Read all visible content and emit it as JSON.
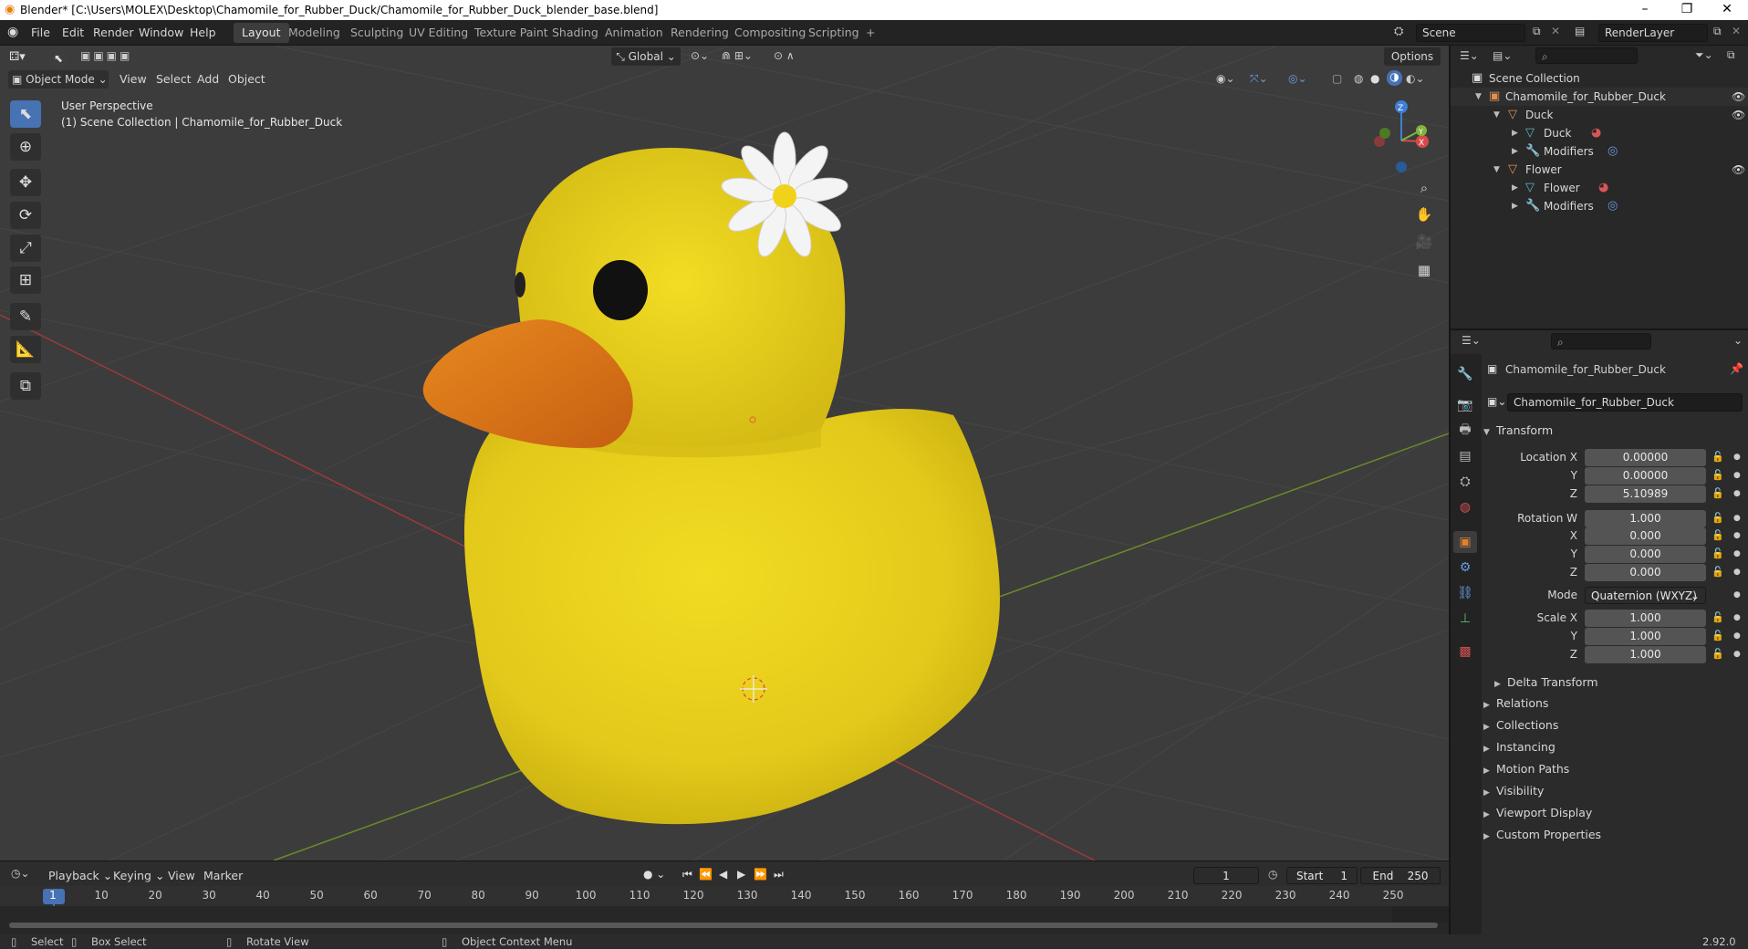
{
  "window": {
    "title": "Blender* [C:\\Users\\MOLEX\\Desktop\\Chamomile_for_Rubber_Duck/Chamomile_for_Rubber_Duck_blender_base.blend]",
    "minimize": "–",
    "maximize": "❐",
    "close": "✕"
  },
  "menus": [
    "File",
    "Edit",
    "Render",
    "Window",
    "Help"
  ],
  "workspaces": [
    "Layout",
    "Modeling",
    "Sculpting",
    "UV Editing",
    "Texture Paint",
    "Shading",
    "Animation",
    "Rendering",
    "Compositing",
    "Scripting",
    "+"
  ],
  "scene": {
    "name": "Scene",
    "render_layer": "RenderLayer"
  },
  "toolbar": {
    "orientation": "Global",
    "options": "Options"
  },
  "viewport": {
    "mode": "Object Mode",
    "menus": [
      "View",
      "Select",
      "Add",
      "Object"
    ],
    "overlay_line1": "User Perspective",
    "overlay_line2": "(1) Scene Collection | Chamomile_for_Rubber_Duck",
    "gizmo": {
      "x": "X",
      "y": "Y",
      "z": "Z"
    }
  },
  "outliner": {
    "root": "Scene Collection",
    "items": [
      {
        "label": "Chamomile_for_Rubber_Duck"
      },
      {
        "label": "Duck"
      },
      {
        "label": "Duck"
      },
      {
        "label": "Modifiers"
      },
      {
        "label": "Flower"
      },
      {
        "label": "Flower"
      },
      {
        "label": "Modifiers"
      }
    ]
  },
  "properties": {
    "object_name": "Chamomile_for_Rubber_Duck",
    "data_name": "Chamomile_for_Rubber_Duck",
    "transform_title": "Transform",
    "location": {
      "label_x": "Location X",
      "label_y": "Y",
      "label_z": "Z",
      "x": "0.00000",
      "y": "0.00000",
      "z": "5.10989"
    },
    "rotation": {
      "label_w": "Rotation W",
      "label_x": "X",
      "label_y": "Y",
      "label_z": "Z",
      "w": "1.000",
      "x": "0.000",
      "y": "0.000",
      "z": "0.000"
    },
    "mode": {
      "label": "Mode",
      "value": "Quaternion (WXYZ)"
    },
    "scale": {
      "label_x": "Scale X",
      "label_y": "Y",
      "label_z": "Z",
      "x": "1.000",
      "y": "1.000",
      "z": "1.000"
    },
    "delta_transform": "Delta Transform",
    "panels": [
      "Relations",
      "Collections",
      "Instancing",
      "Motion Paths",
      "Visibility",
      "Viewport Display",
      "Custom Properties"
    ]
  },
  "timeline": {
    "menus": [
      "Playback",
      "Keying",
      "View",
      "Marker"
    ],
    "current_frame": "1",
    "start_label": "Start",
    "start": "1",
    "end_label": "End",
    "end": "250",
    "ruler": [
      "1",
      "10",
      "20",
      "30",
      "40",
      "50",
      "60",
      "70",
      "80",
      "90",
      "100",
      "110",
      "120",
      "130",
      "140",
      "150",
      "160",
      "170",
      "180",
      "190",
      "200",
      "210",
      "220",
      "230",
      "240",
      "250"
    ]
  },
  "statusbar": {
    "select": "Select",
    "box_select": "Box Select",
    "rotate_view": "Rotate View",
    "context_menu": "Object Context Menu",
    "version": "2.92.0"
  },
  "colors": {
    "accent": "#4772b3",
    "duck_body": "#e9d41c",
    "beak": "#e07a1c",
    "background": "#3c3c3c"
  }
}
